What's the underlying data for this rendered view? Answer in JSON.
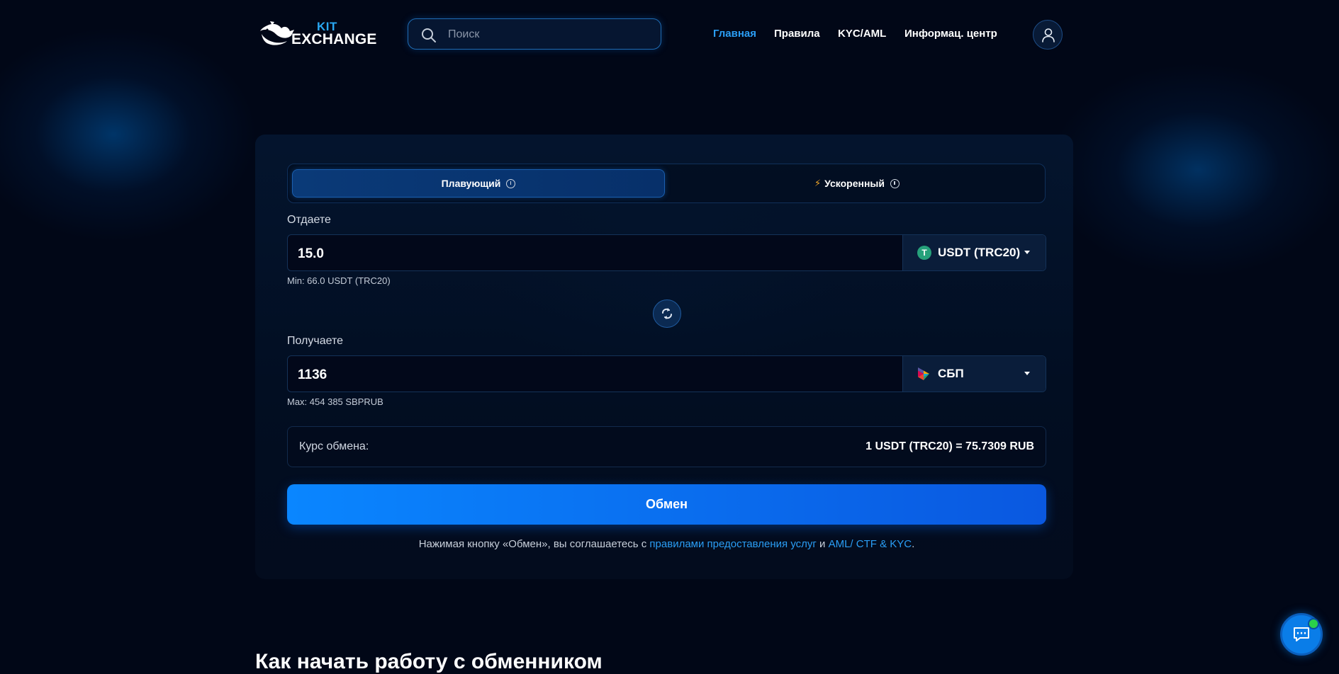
{
  "brand": {
    "top": "KIT",
    "bottom": "EXCHANGE",
    "icon": "whale-logo-icon"
  },
  "search": {
    "placeholder": "Поиск",
    "icon": "search-icon"
  },
  "nav": [
    {
      "label": "Главная",
      "active": true
    },
    {
      "label": "Правила",
      "active": false
    },
    {
      "label": "KYC/AML",
      "active": false
    },
    {
      "label": "Информац. центр",
      "active": false
    }
  ],
  "profile": {
    "icon": "user-icon"
  },
  "mode": {
    "floating": "Плавующий",
    "accelerated": "Ускоренный",
    "active": "floating"
  },
  "give": {
    "label": "Отдаете",
    "amount": "15.0",
    "currency": "USDT (TRC20)",
    "currency_icon": "tether-icon",
    "hint": "Min: 66.0 USDT (TRC20)"
  },
  "receive": {
    "label": "Получаете",
    "amount": "1136",
    "currency": "СБП",
    "currency_icon": "sbp-icon",
    "hint": "Max: 454 385 SBPRUB"
  },
  "rate": {
    "label": "Курс обмена:",
    "value": "1 USDT (TRC20) = 75.7309 RUB"
  },
  "submit": {
    "label": "Обмен"
  },
  "consent": {
    "prefix": "Нажимая кнопку «Обмен», вы соглашаетесь с ",
    "link1": "правилами предоставления услуг",
    "middle": " и ",
    "link2": "AML/ CTF & KYC",
    "suffix": "."
  },
  "section": {
    "title": "Как начать работу с обменником"
  },
  "colors": {
    "accent": "#2a9df4",
    "button": "#0a86ff",
    "background": "#010717",
    "tether": "#26a17b",
    "online": "#2ad14a"
  }
}
